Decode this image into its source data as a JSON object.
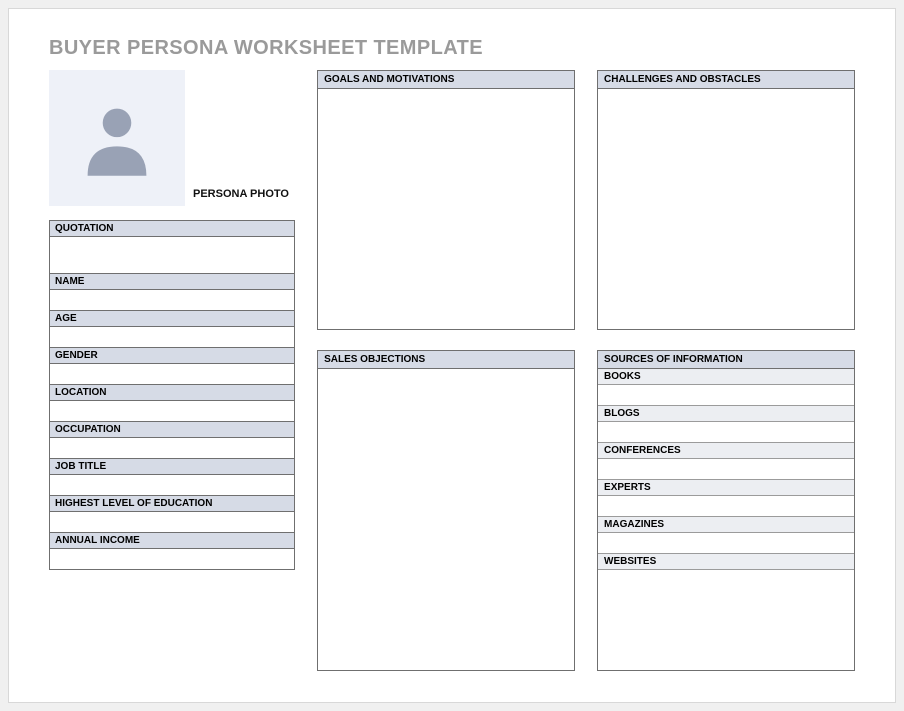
{
  "title": "BUYER PERSONA WORKSHEET TEMPLATE",
  "photo_label": "PERSONA PHOTO",
  "left_fields": {
    "quotation": "QUOTATION",
    "name": "NAME",
    "age": "AGE",
    "gender": "GENDER",
    "location": "LOCATION",
    "occupation": "OCCUPATION",
    "job_title": "JOB TITLE",
    "education": "HIGHEST LEVEL OF EDUCATION",
    "income": "ANNUAL INCOME"
  },
  "mid": {
    "goals": "GOALS AND MOTIVATIONS",
    "objections": "SALES OBJECTIONS"
  },
  "right": {
    "challenges": "CHALLENGES AND OBSTACLES",
    "sources": "SOURCES OF INFORMATION",
    "sub": {
      "books": "BOOKS",
      "blogs": "BLOGS",
      "conferences": "CONFERENCES",
      "experts": "EXPERTS",
      "magazines": "MAGAZINES",
      "websites": "WEBSITES"
    }
  }
}
